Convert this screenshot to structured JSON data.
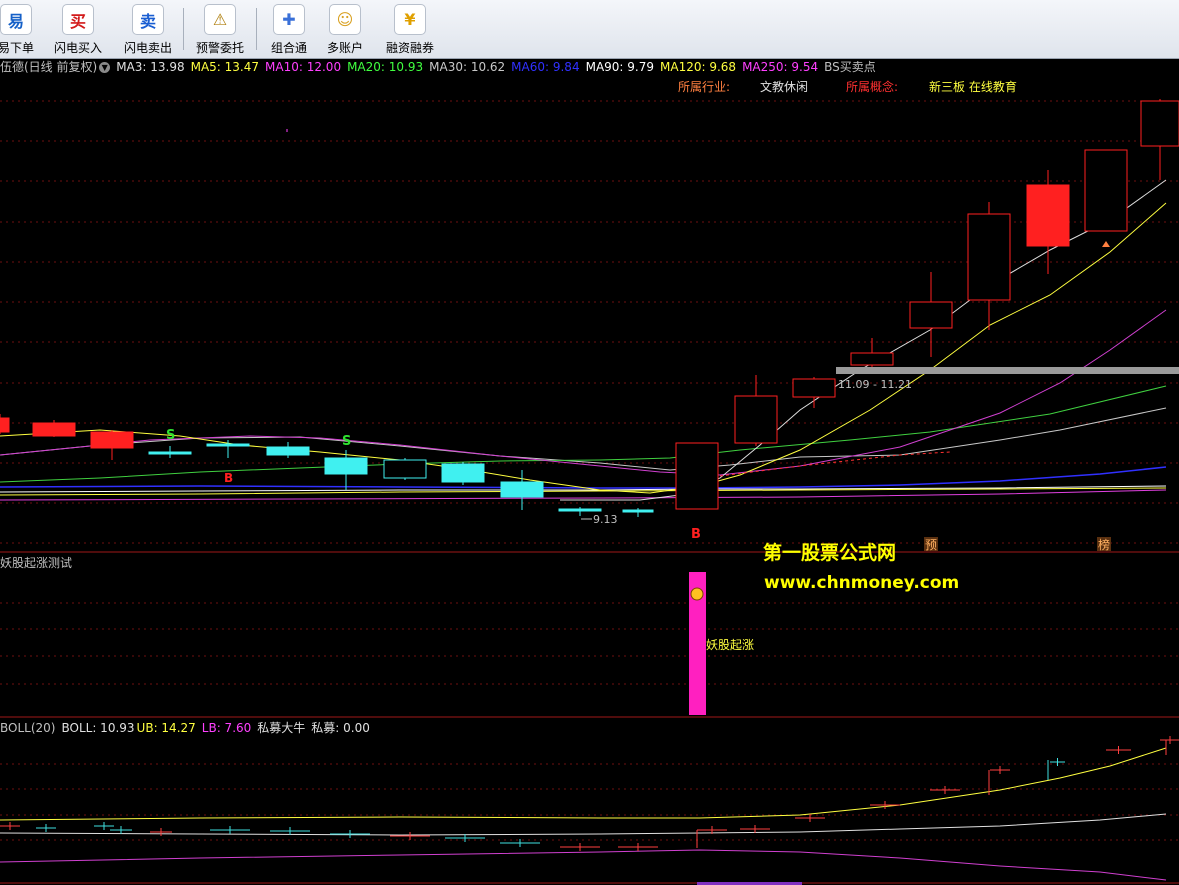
{
  "toolbar": {
    "buttons": [
      {
        "label": "易下单",
        "icon": "trade-icon",
        "glyph": "易",
        "color": "#1560c8"
      },
      {
        "label": "闪电买入",
        "icon": "buy-icon",
        "glyph": "买",
        "color": "#d21a1a"
      },
      {
        "label": "闪电卖出",
        "icon": "sell-icon",
        "glyph": "卖",
        "color": "#1a5ed2"
      },
      {
        "label": "预警委托",
        "icon": "alert-icon",
        "glyph": "⚠",
        "color": "#b08010"
      },
      {
        "label": "组合通",
        "icon": "puzzle-icon",
        "glyph": "✚",
        "color": "#3a70d8"
      },
      {
        "label": "多账户",
        "icon": "accounts-icon",
        "glyph": "☺",
        "color": "#d8a020"
      },
      {
        "label": "融资融券",
        "icon": "margin-icon",
        "glyph": "¥",
        "color": "#e0a000"
      }
    ]
  },
  "main_chart": {
    "title": "伍德(日线 前复权)",
    "indicators": [
      {
        "text": "MA3: 13.98",
        "color": "#e0e0e0"
      },
      {
        "text": "MA5: 13.47",
        "color": "#ffff40"
      },
      {
        "text": "MA10: 12.00",
        "color": "#ff40ff"
      },
      {
        "text": "MA20: 10.93",
        "color": "#40ff40"
      },
      {
        "text": "MA30: 10.62",
        "color": "#c8c8c8"
      },
      {
        "text": "MA60: 9.84",
        "color": "#3030ff"
      },
      {
        "text": "MA90: 9.79",
        "color": "#ffffff"
      },
      {
        "text": "MA120: 9.68",
        "color": "#ffff40"
      },
      {
        "text": "MA250: 9.54",
        "color": "#ff40ff"
      },
      {
        "text": "BS买卖点",
        "color": "#c0c0c0"
      }
    ],
    "industry_label": "所属行业:",
    "industry_value": "文教休闲",
    "concept_label": "所属概念:",
    "concept_value": "新三板 在线教育",
    "low_label": "9.13",
    "range_label": "11.09 - 11.21",
    "marker_b_main": "B",
    "marker_b_small": "B",
    "marker_s1": "S",
    "marker_s2": "S",
    "badge_yu": "预",
    "badge_bang": "榜",
    "watermark_title": "第一股票公式网",
    "watermark_url": "www.chnmoney.com"
  },
  "sub_chart1": {
    "title": "妖股起涨测试",
    "signal_label": "妖股起涨"
  },
  "sub_chart2": {
    "title": "BOLL(20)",
    "boll": "BOLL: 10.93",
    "ub": "UB: 14.27",
    "lb": "LB: 7.60",
    "pm1": "私募大牛",
    "pm2": "私募: 0.00"
  }
}
